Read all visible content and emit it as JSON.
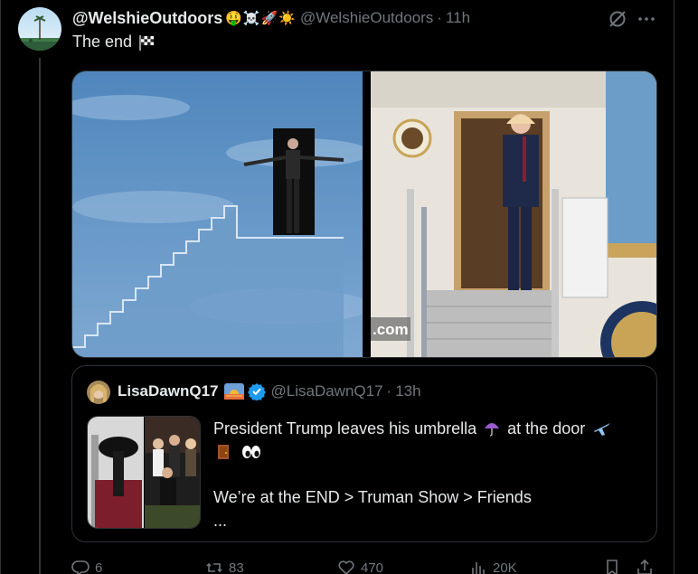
{
  "tweet": {
    "display_name": "@WelshieOutdoors",
    "name_emojis": "🤑☠️🚀☀️",
    "handle": "@WelshieOutdoors",
    "separator": "·",
    "time": "11h",
    "text": "The end",
    "text_icon": "checkered-flag-icon",
    "media": [
      {
        "description_icon": "man-at-door-in-sky-image"
      },
      {
        "description_icon": "trump-at-plane-door-image",
        "watermark": ".com"
      }
    ]
  },
  "quote": {
    "display_name": "LisaDawnQ17",
    "name_emoji": "sunrise-icon",
    "verified": true,
    "handle": "@LisaDawnQ17",
    "separator": "·",
    "time": "13h",
    "line1": "President Trump leaves his umbrella",
    "line1b": "at the door",
    "line3": "We’re at the END > Truman Show > Friends",
    "line4": "..."
  },
  "actions": {
    "replies": "6",
    "reposts": "83",
    "likes": "470",
    "views": "20K"
  },
  "colors": {
    "background": "#000000",
    "text_primary": "#e7e9ea",
    "text_secondary": "#71767b",
    "border": "#2f3336",
    "verified": "#1d9bf0"
  }
}
